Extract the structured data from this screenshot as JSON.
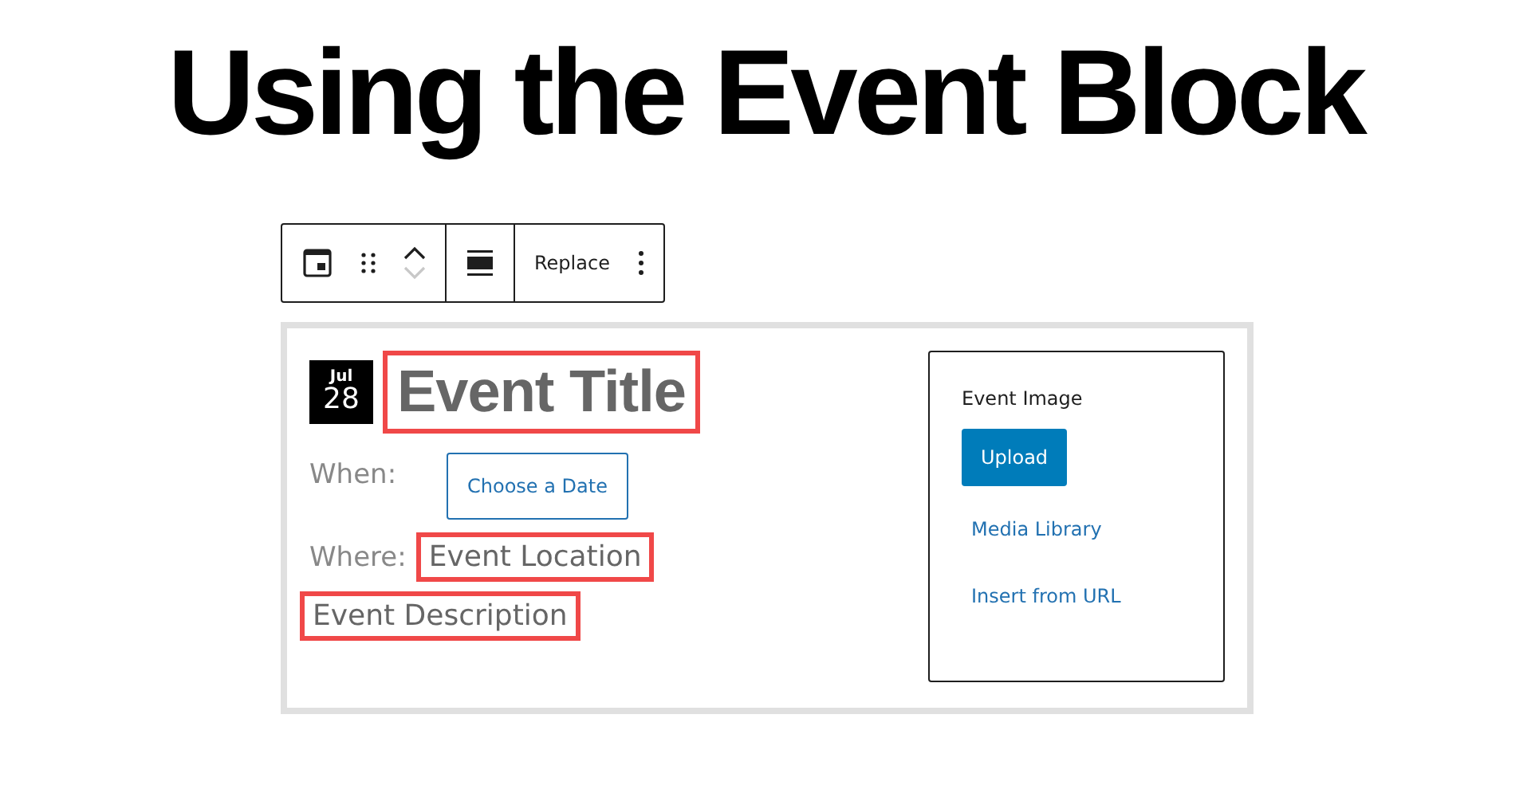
{
  "heading": "Using the Event Block",
  "toolbar": {
    "move_up": {
      "disabled": false
    },
    "move_down": {
      "disabled": true
    },
    "replace_label": "Replace"
  },
  "event": {
    "date_badge": {
      "month": "Jul",
      "day": "28"
    },
    "title": {
      "text": "Event Title",
      "highlighted": true
    },
    "when": {
      "label": "When:",
      "button": "Choose a Date"
    },
    "where": {
      "label": "Where:",
      "value": "Event Location",
      "highlighted": true
    },
    "description": {
      "text": "Event Description",
      "highlighted": true
    },
    "image_panel": {
      "title": "Event Image",
      "upload": "Upload",
      "links": [
        "Media Library",
        "Insert from URL"
      ]
    }
  }
}
